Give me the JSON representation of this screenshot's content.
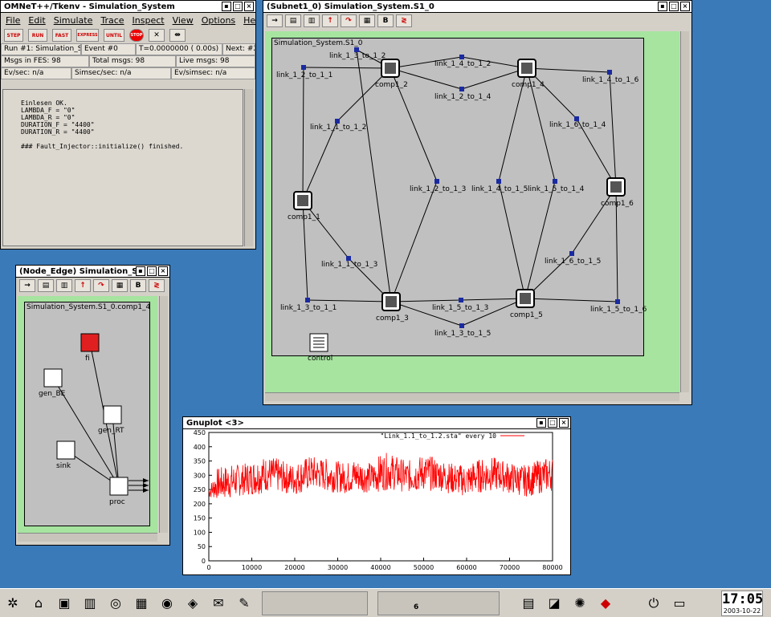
{
  "tkenv": {
    "title": "OMNeT++/Tkenv - Simulation_System",
    "menu": [
      "File",
      "Edit",
      "Simulate",
      "Trace",
      "Inspect",
      "View",
      "Options",
      "Help"
    ],
    "toolbar": [
      "STEP",
      "RUN",
      "FAST",
      "EXPRESS",
      "UNTIL",
      "STOP"
    ],
    "status": {
      "run": "Run #1: Simulation_Sy",
      "event": "Event #0",
      "time": "T=0.0000000  ( 0.00s)",
      "next": "Next: #2",
      "fes": "Msgs in FES: 98",
      "total": "Total msgs: 98",
      "live": "Live msgs: 98",
      "evsec": "Ev/sec: n/a",
      "simsec": "Simsec/sec: n/a",
      "evsimsec": "Ev/simsec: n/a"
    },
    "log": "Einlesen OK.\nLAMBDA_F = \"0\"\nLAMBDA_R = \"0\"\nDURATION_F = \"4400\"\nDURATION_R = \"4400\"\n\n### Fault_Injector::initialize() finished."
  },
  "subnet": {
    "title": "(Subnet1_0) Simulation_System.S1_0",
    "caption": "Simulation_System.S1_0",
    "nodes": [
      {
        "id": "comp1_1",
        "label": "comp1_1"
      },
      {
        "id": "comp1_2",
        "label": "comp1_2"
      },
      {
        "id": "comp1_3",
        "label": "comp1_3"
      },
      {
        "id": "comp1_4",
        "label": "comp1_4"
      },
      {
        "id": "comp1_5",
        "label": "comp1_5"
      },
      {
        "id": "comp1_6",
        "label": "comp1_6"
      }
    ],
    "links": [
      "link_1_1_to_1_2",
      "link_1_1_to_1_3",
      "link_1_2_to_1_1",
      "link_1_2_to_1_3",
      "link_1_2_to_1_4",
      "link_1_3_to_1_1",
      "link_1_3_to_1_2",
      "link_1_3_to_1_5",
      "link_1_4_to_1_2",
      "link_1_4_to_1_5",
      "link_1_4_to_1_6",
      "link_1_5_to_1_3",
      "link_1_5_to_1_4",
      "link_1_5_to_1_6",
      "link_1_6_to_1_4",
      "link_1_6_to_1_5"
    ],
    "control_label": "control"
  },
  "node_edge": {
    "title": "(Node_Edge) Simulation_Sy",
    "caption": "Simulation_System.S1_0.comp1_4",
    "modules": [
      {
        "id": "fi",
        "label": "fi"
      },
      {
        "id": "gen_BE",
        "label": "gen_BE"
      },
      {
        "id": "gen_RT",
        "label": "gen_RT"
      },
      {
        "id": "sink",
        "label": "sink"
      },
      {
        "id": "proc",
        "label": "proc"
      }
    ]
  },
  "gnuplot": {
    "title": "Gnuplot <3>",
    "chart_data": {
      "type": "line",
      "title": "",
      "xlabel": "",
      "ylabel": "",
      "xlim": [
        0,
        80000
      ],
      "ylim": [
        0,
        450
      ],
      "xticks": [
        0,
        10000,
        20000,
        30000,
        40000,
        50000,
        60000,
        70000,
        80000
      ],
      "yticks": [
        0,
        50,
        100,
        150,
        200,
        250,
        300,
        350,
        400,
        450
      ],
      "series": [
        {
          "name": "\"Link_1.1_to_1.2.sta\" every 10",
          "color": "#ff0000",
          "x": [
            0,
            2000,
            4000,
            6000,
            8000,
            10000,
            12000,
            14000,
            16000,
            18000,
            20000,
            22000,
            24000,
            26000,
            28000,
            30000,
            32000,
            34000,
            36000,
            38000,
            40000,
            42000,
            44000,
            46000,
            48000,
            50000,
            52000,
            54000,
            56000,
            58000,
            60000,
            62000,
            64000,
            66000,
            68000,
            70000,
            72000,
            74000,
            76000,
            78000,
            80000
          ],
          "mean": [
            240,
            270,
            275,
            280,
            285,
            290,
            300,
            305,
            300,
            290,
            285,
            300,
            310,
            305,
            300,
            295,
            290,
            300,
            295,
            290,
            310,
            315,
            305,
            295,
            300,
            310,
            305,
            300,
            290,
            285,
            280,
            295,
            300,
            305,
            300,
            290,
            285,
            280,
            290,
            300,
            305
          ],
          "amplitude": [
            20,
            55,
            60,
            60,
            55,
            60,
            65,
            60,
            60,
            55,
            55,
            60,
            60,
            55,
            60,
            55,
            55,
            60,
            55,
            55,
            65,
            65,
            60,
            55,
            60,
            65,
            60,
            55,
            55,
            55,
            55,
            60,
            60,
            60,
            55,
            55,
            55,
            55,
            60,
            60,
            60
          ]
        }
      ]
    }
  },
  "taskbar": {
    "clock": "17:05",
    "date": "2003-10-22",
    "pager_active": "6"
  }
}
